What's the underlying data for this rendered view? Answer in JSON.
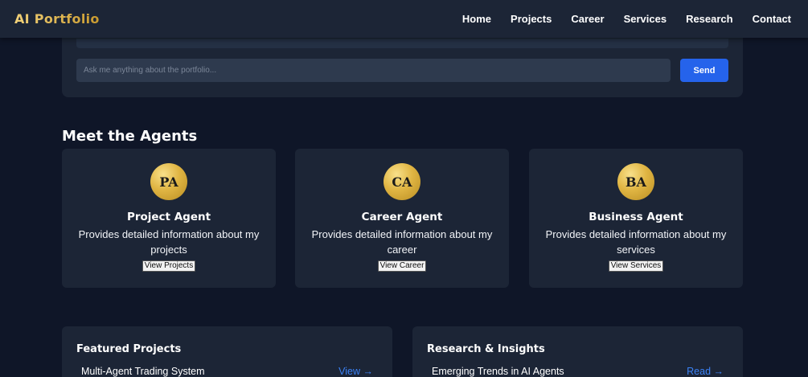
{
  "header": {
    "logo": "AI Portfolio",
    "nav": [
      "Home",
      "Projects",
      "Career",
      "Services",
      "Research",
      "Contact"
    ]
  },
  "chat": {
    "placeholder": "Ask me anything about the portfolio...",
    "send_label": "Send"
  },
  "agents": {
    "title": "Meet the Agents",
    "items": [
      {
        "initials": "PA",
        "name": "Project Agent",
        "desc": "Provides detailed information about my projects",
        "button": "View Projects"
      },
      {
        "initials": "CA",
        "name": "Career Agent",
        "desc": "Provides detailed information about my career",
        "button": "View Career"
      },
      {
        "initials": "BA",
        "name": "Business Agent",
        "desc": "Provides detailed information about my services",
        "button": "View Services"
      }
    ]
  },
  "featured": {
    "title": "Featured Projects",
    "item": "Multi-Agent Trading System",
    "link": "View →"
  },
  "research": {
    "title": "Research & Insights",
    "item": "Emerging Trends in AI Agents",
    "link": "Read →"
  },
  "colors": {
    "background": "#0f1628",
    "panel": "#1c2536",
    "accent": "#2563eb",
    "gold": "#d9b24a",
    "link": "#3b82f6"
  }
}
